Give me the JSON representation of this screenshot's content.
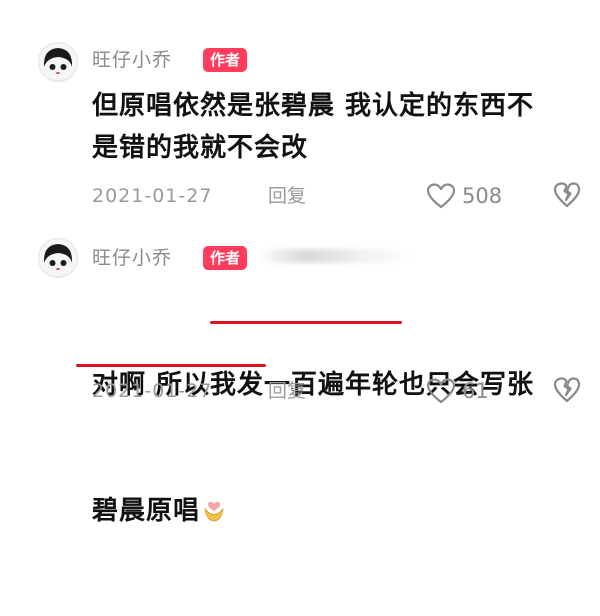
{
  "comments": [
    {
      "username": "旺仔小乔",
      "badge": "作者",
      "text": "但原唱依然是张碧晨 我认定的东西不\n是错的我就不会改",
      "date": "2021-01-27",
      "reply_label": "回复",
      "likes": "508"
    },
    {
      "username": "旺仔小乔",
      "badge": "作者",
      "text_line1": "对啊 所以我发一百遍年轮也只会写张",
      "text_line2": "碧晨原唱",
      "emoji_icon": "hands-heart-emoji",
      "date": "2021-01-27",
      "reply_label": "回复",
      "likes": "61"
    }
  ],
  "colors": {
    "badge": "#ff3c5c",
    "underline": "#d9141e",
    "meta": "#9a9a9a"
  }
}
